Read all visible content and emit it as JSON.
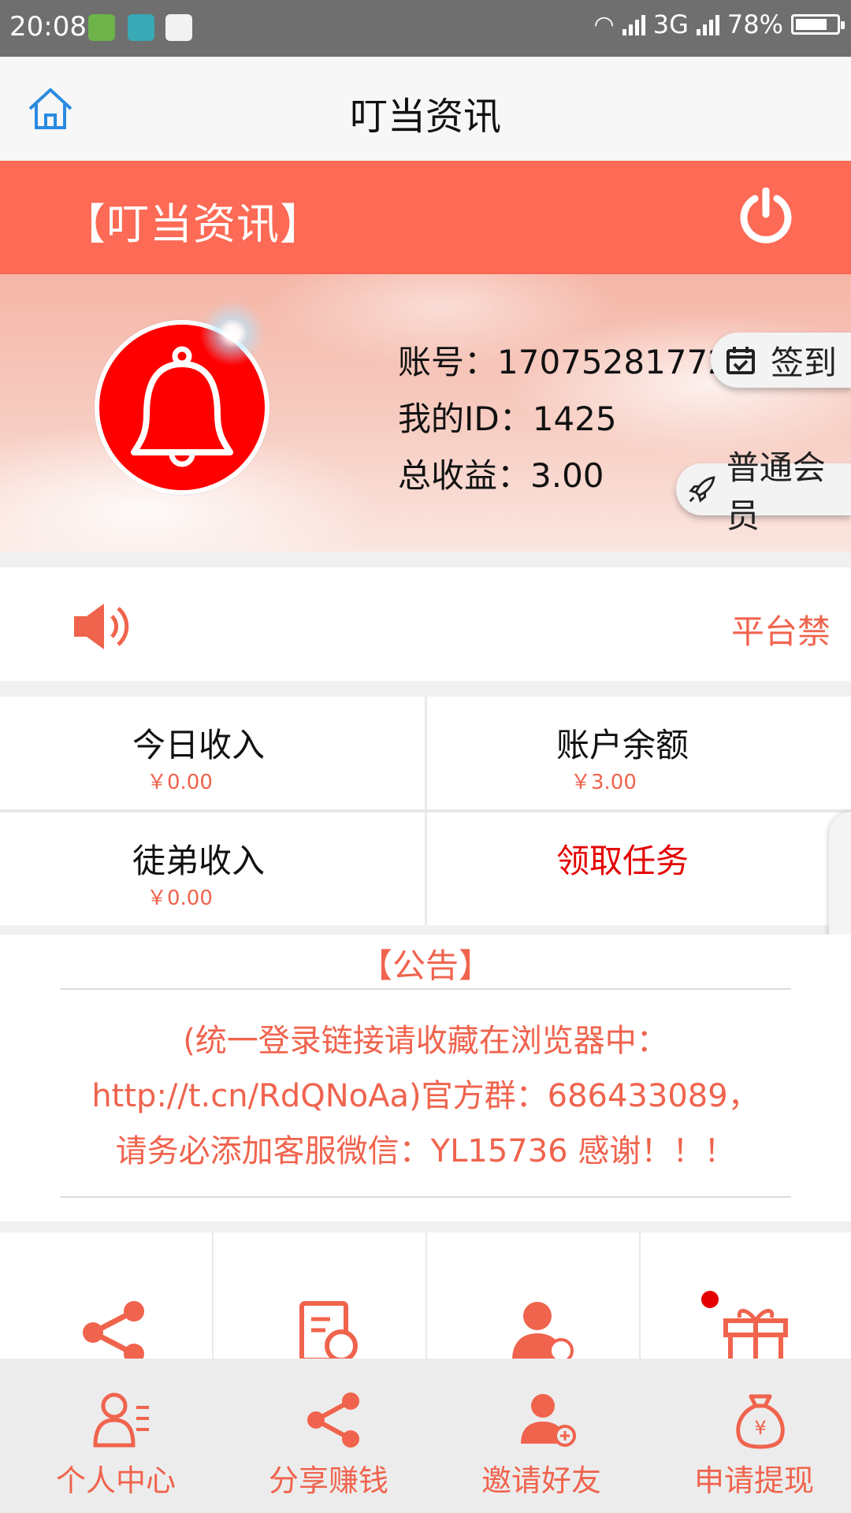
{
  "status_bar": {
    "time": "20:08",
    "network": "3G",
    "battery": "78%",
    "battery_level": 0.78
  },
  "header": {
    "title": "叮当资讯"
  },
  "banner": {
    "title": "【叮当资讯】"
  },
  "profile": {
    "account_label": "账号：",
    "account": "17075281772",
    "id_label": "我的ID：",
    "id": "1425",
    "earnings_label": "总收益：",
    "earnings": "3.00",
    "checkin_label": "签到",
    "member_label": "普通会员"
  },
  "notice": {
    "text": "平台禁"
  },
  "stats": {
    "today_label": "今日收入",
    "today_value": "￥0.00",
    "balance_label": "账户余额",
    "balance_value": "￥3.00",
    "apprentice_label": "徒弟收入",
    "apprentice_value": "￥0.00",
    "task_label": "领取任务"
  },
  "announcement": {
    "heading": "【公告】",
    "line1": "(统一登录链接请收藏在浏览器中：",
    "line2": "http://t.cn/RdQNoAa)官方群：686433089，",
    "line3": "请务必添加客服微信：YL15736 感谢！！！"
  },
  "tabs": [
    {
      "label": "个人中心",
      "icon": "profile-list-icon"
    },
    {
      "label": "分享赚钱",
      "icon": "share-icon"
    },
    {
      "label": "邀请好友",
      "icon": "add-user-icon"
    },
    {
      "label": "申请提现",
      "icon": "money-bag-icon"
    }
  ],
  "colors": {
    "accent": "#fd6a55",
    "accent_text": "#f0634d",
    "red": "#e40000"
  }
}
